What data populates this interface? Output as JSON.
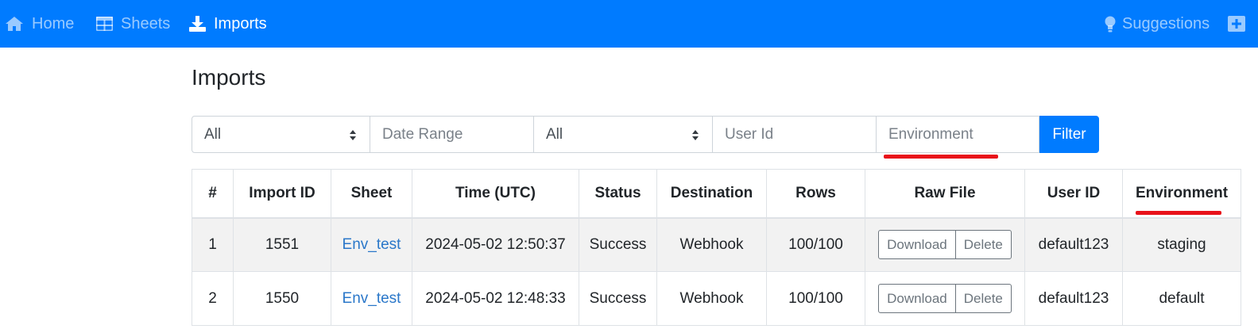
{
  "nav": {
    "home": "Home",
    "sheets": "Sheets",
    "imports": "Imports",
    "suggestions": "Suggestions"
  },
  "icons": {
    "home": "home-icon",
    "sheets": "table-icon",
    "imports": "download-icon",
    "suggestions": "lightbulb-icon",
    "overflow": "plus-square-icon"
  },
  "page": {
    "title": "Imports"
  },
  "filters": {
    "status_select": "All",
    "date_range_placeholder": "Date Range",
    "destination_select": "All",
    "user_id_placeholder": "User Id",
    "environment_placeholder": "Environment",
    "filter_button": "Filter"
  },
  "table": {
    "headers": [
      "#",
      "Import ID",
      "Sheet",
      "Time (UTC)",
      "Status",
      "Destination",
      "Rows",
      "Raw File",
      "User ID",
      "Environment"
    ],
    "rows": [
      {
        "index": "1",
        "import_id": "1551",
        "sheet": "Env_test",
        "time": "2024-05-02 12:50:37",
        "status": "Success",
        "destination": "Webhook",
        "rows": "100/100",
        "download": "Download",
        "delete": "Delete",
        "user_id": "default123",
        "environment": "staging"
      },
      {
        "index": "2",
        "import_id": "1550",
        "sheet": "Env_test",
        "time": "2024-05-02 12:48:33",
        "status": "Success",
        "destination": "Webhook",
        "rows": "100/100",
        "download": "Download",
        "delete": "Delete",
        "user_id": "default123",
        "environment": "default"
      }
    ]
  },
  "colors": {
    "navbar": "#007bff",
    "highlight_underline": "#e8111a",
    "rows_success": "#3f9a3f",
    "link": "#2a77c9"
  }
}
